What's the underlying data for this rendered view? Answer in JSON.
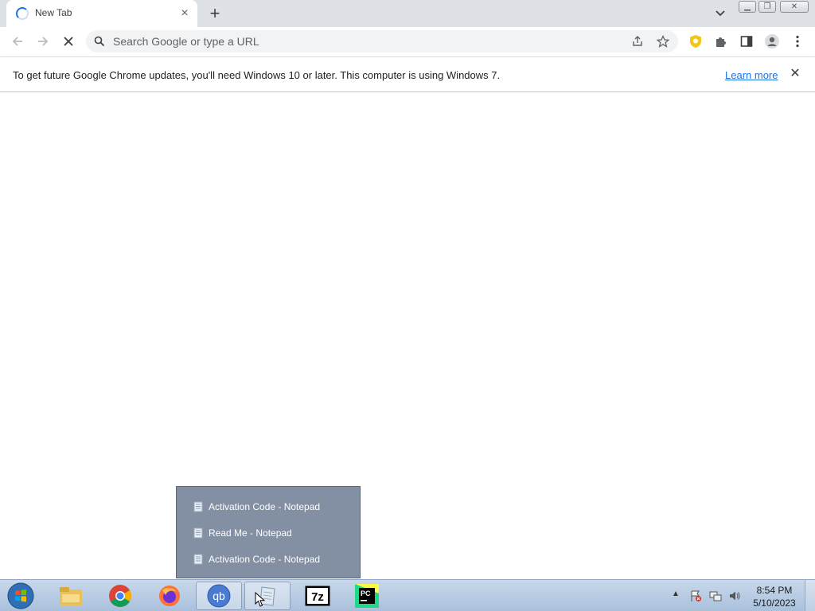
{
  "browser": {
    "tab": {
      "title": "New Tab",
      "close_glyph": "×"
    },
    "new_tab_glyph": "+",
    "omnibox": {
      "placeholder": "Search Google or type a URL"
    },
    "infobar": {
      "message": "To get future Google Chrome updates, you'll need Windows 10 or later. This computer is using Windows 7.",
      "link": "Learn more",
      "close_glyph": "✕"
    }
  },
  "jumplist": {
    "items": [
      {
        "label": "Activation Code - Notepad"
      },
      {
        "label": "Read Me - Notepad"
      },
      {
        "label": "Activation Code - Notepad"
      }
    ]
  },
  "taskbar": {
    "apps": [
      "file-explorer",
      "google-chrome",
      "firefox",
      "qbittorrent",
      "notepad",
      "7-zip",
      "pycharm"
    ],
    "active_app": "notepad",
    "qb_label": "qb",
    "sevenzip_label": "7z",
    "pycharm_label": "PC"
  },
  "clock": {
    "time": "8:54 PM",
    "date": "5/10/2023"
  },
  "colors": {
    "accent": "#1a73e8",
    "tabstrip": "#dee1e6",
    "taskbar": "#b8cbe2",
    "popup": "#7e8ba0"
  }
}
